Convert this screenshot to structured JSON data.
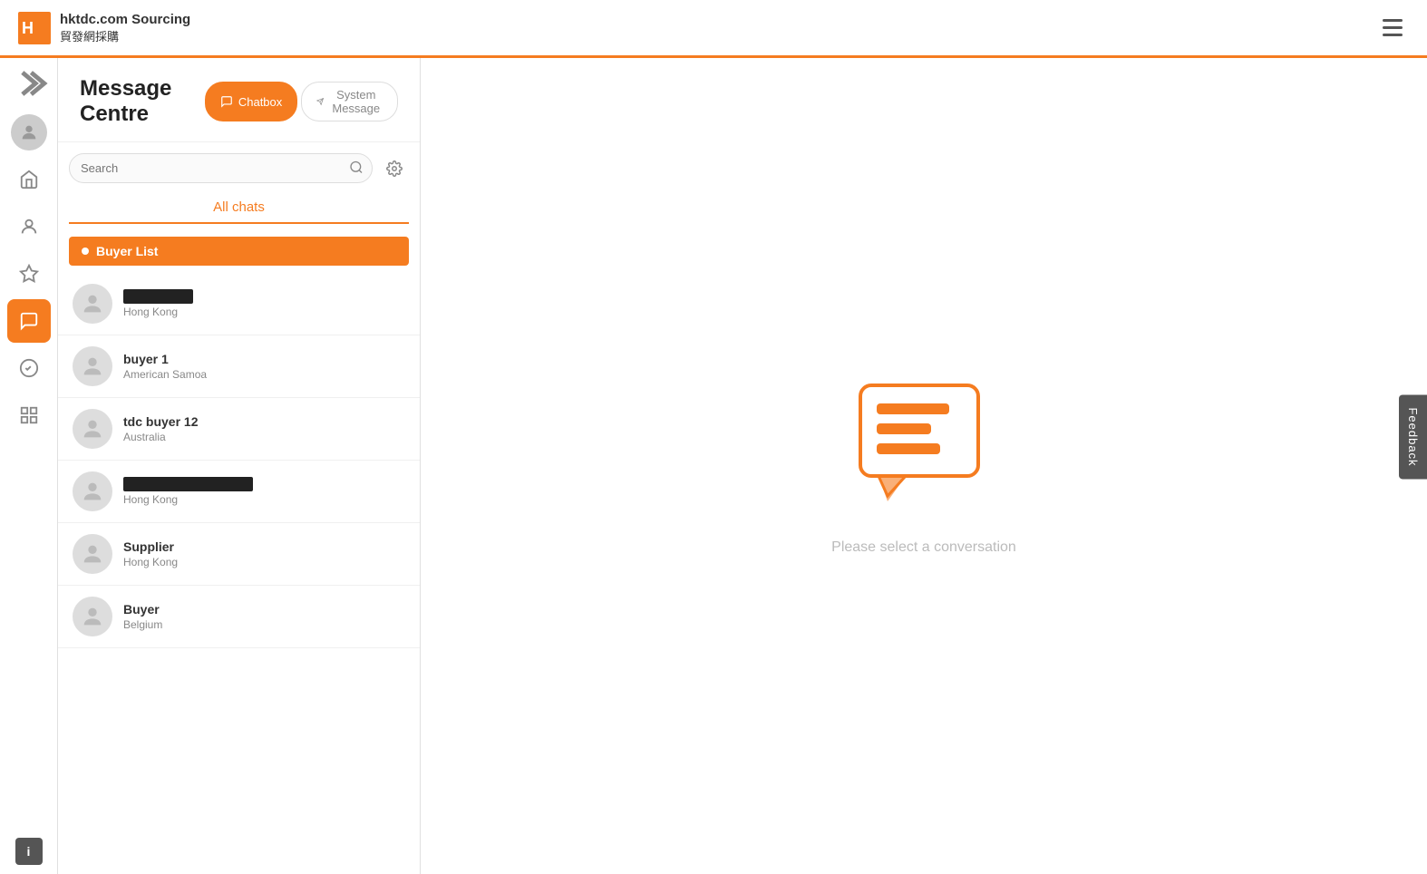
{
  "header": {
    "brand_en": "hktdc.com Sourcing",
    "brand_cn": "貿發網採購",
    "logo_alt": "hktdc logo"
  },
  "page": {
    "title": "Message Centre",
    "tabs": [
      {
        "id": "chatbox",
        "label": "Chatbox",
        "active": true
      },
      {
        "id": "system-message",
        "label": "System Message",
        "active": false
      }
    ]
  },
  "search": {
    "placeholder": "Search"
  },
  "all_chats": {
    "label": "All chats"
  },
  "buyer_list": {
    "label": "Buyer List"
  },
  "contacts": [
    {
      "id": 1,
      "name": "REDACTED",
      "location": "Hong Kong",
      "redacted": true
    },
    {
      "id": 2,
      "name": "buyer 1",
      "location": "American Samoa",
      "redacted": false
    },
    {
      "id": 3,
      "name": "tdc buyer 12",
      "location": "Australia",
      "redacted": false
    },
    {
      "id": 4,
      "name": "REDACTED_LONG",
      "location": "Hong Kong",
      "redacted": true
    },
    {
      "id": 5,
      "name": "Supplier",
      "location": "Hong Kong",
      "redacted": false
    },
    {
      "id": 6,
      "name": "Buyer",
      "location": "Belgium",
      "redacted": false
    }
  ],
  "empty_state": {
    "text": "Please select a conversation"
  },
  "feedback": {
    "label": "Feedback"
  },
  "nav": {
    "expand_icon": "≫",
    "info_icon": "i"
  }
}
